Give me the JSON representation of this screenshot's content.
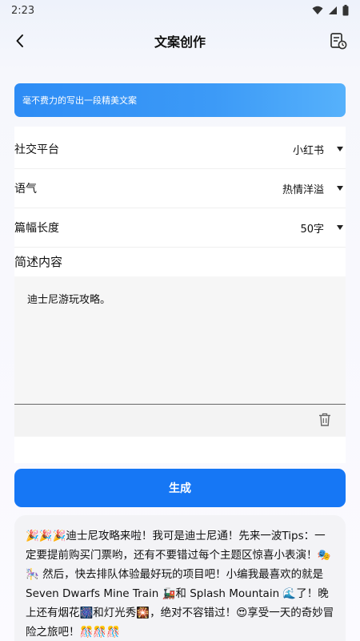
{
  "status_bar": {
    "time": "2:23"
  },
  "header": {
    "title": "文案创作"
  },
  "banner": {
    "text": "毫不费力的写出一段精美文案"
  },
  "form": {
    "platform": {
      "label": "社交平台",
      "value": "小红书"
    },
    "tone": {
      "label": "语气",
      "value": "热情洋溢"
    },
    "length": {
      "label": "篇幅长度",
      "value": "50字"
    },
    "description_label": "简述内容",
    "description_value": "迪士尼游玩攻略。"
  },
  "generate_button": "生成",
  "result": {
    "text": "🎉🎉🎉迪士尼攻略来啦！我可是迪士尼通！先来一波Tips：一定要提前购买门票哟，还有不要错过每个主题区惊喜小表演！🎭🎠 然后，快去排队体验最好玩的项目吧！小编我最喜欢的就是 Seven Dwarfs Mine Train 🚂和 Splash Mountain 🌊了！晚上还有烟花🎆和灯光秀🎇，绝对不容错过！😍享受一天的奇妙冒险之旅吧！🎊🎊🎊"
  },
  "icons": {
    "back": "chevron-left-icon",
    "history": "document-clock-icon",
    "delete": "trash-icon"
  },
  "colors": {
    "accent": "#1677f5",
    "banner_start": "#2d8cf5",
    "banner_end": "#56b1fb"
  }
}
